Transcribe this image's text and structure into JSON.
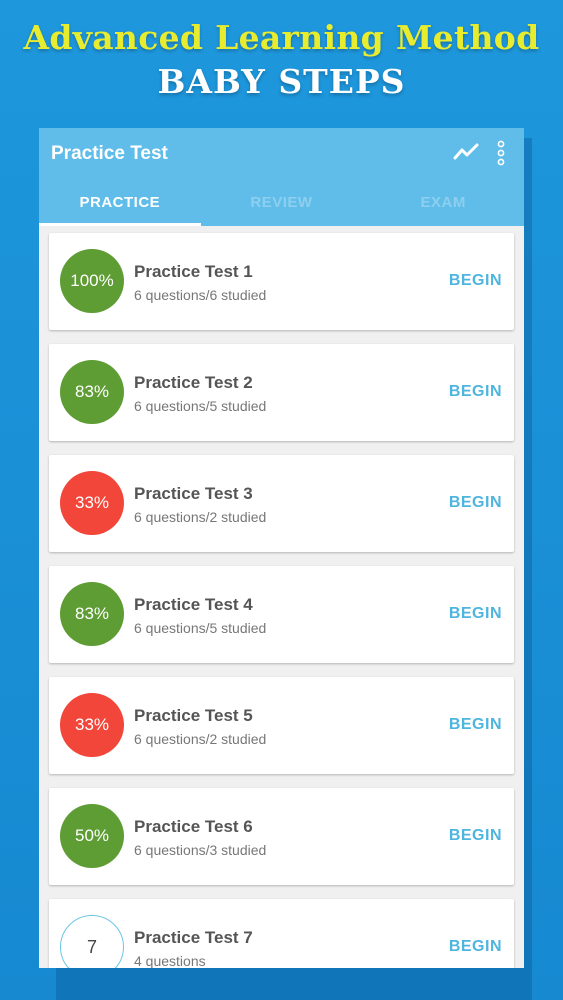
{
  "headline": "Advanced Learning Method",
  "subheadline": "BABY STEPS",
  "app": {
    "title": "Practice Test",
    "icons": {
      "trend": "trend-line-icon",
      "more": "more-vertical-icon"
    },
    "tabs": [
      {
        "label": "PRACTICE",
        "active": true
      },
      {
        "label": "REVIEW",
        "active": false
      },
      {
        "label": "EXAM",
        "active": false
      }
    ]
  },
  "colors": {
    "background": "#1a8fd6",
    "headline": "#e8ec2f",
    "appbar": "#60bde9",
    "green": "#5e9c34",
    "red": "#f2463a",
    "accent": "#4fb5df"
  },
  "tests": [
    {
      "badge": "100%",
      "title": "Practice Test 1",
      "subtitle": "6 questions/6 studied",
      "action": "BEGIN",
      "status": "green"
    },
    {
      "badge": "83%",
      "title": "Practice Test 2",
      "subtitle": "6 questions/5 studied",
      "action": "BEGIN",
      "status": "green"
    },
    {
      "badge": "33%",
      "title": "Practice Test 3",
      "subtitle": "6 questions/2 studied",
      "action": "BEGIN",
      "status": "red"
    },
    {
      "badge": "83%",
      "title": "Practice Test 4",
      "subtitle": "6 questions/5 studied",
      "action": "BEGIN",
      "status": "green"
    },
    {
      "badge": "33%",
      "title": "Practice Test 5",
      "subtitle": "6 questions/2 studied",
      "action": "BEGIN",
      "status": "red"
    },
    {
      "badge": "50%",
      "title": "Practice Test 6",
      "subtitle": "6 questions/3 studied",
      "action": "BEGIN",
      "status": "green"
    },
    {
      "badge": "7",
      "title": "Practice Test 7",
      "subtitle": "4 questions",
      "action": "BEGIN",
      "status": "none"
    }
  ]
}
